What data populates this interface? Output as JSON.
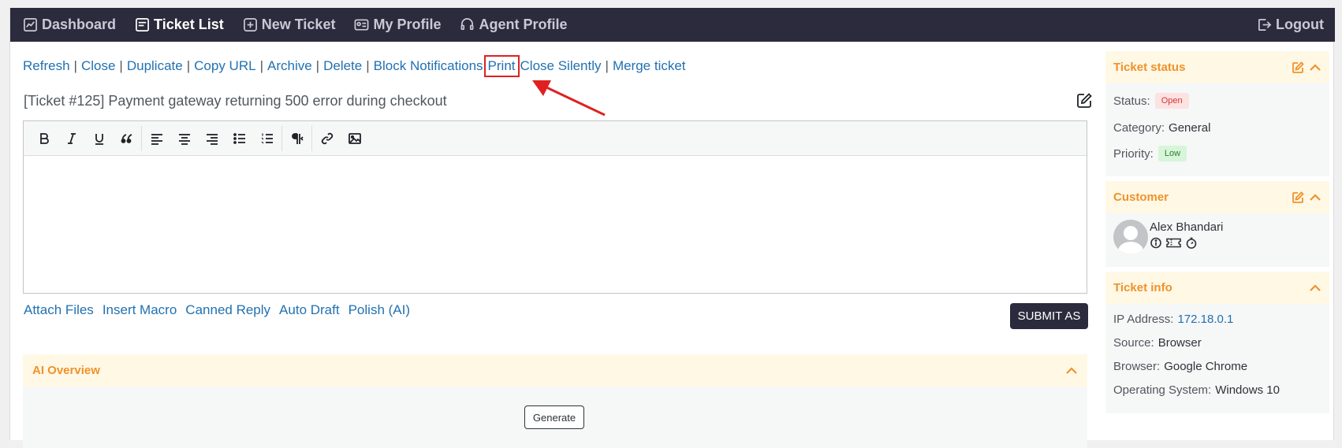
{
  "nav": {
    "items": [
      {
        "label": "Dashboard",
        "icon": "chart-icon"
      },
      {
        "label": "Ticket List",
        "icon": "list-icon"
      },
      {
        "label": "New Ticket",
        "icon": "plus-square-icon"
      },
      {
        "label": "My Profile",
        "icon": "id-card-icon"
      },
      {
        "label": "Agent Profile",
        "icon": "headset-icon"
      }
    ],
    "logout": "Logout"
  },
  "actions": [
    "Refresh",
    "Close",
    "Duplicate",
    "Copy URL",
    "Archive",
    "Delete",
    "Block Notifications",
    "Print",
    "Close Silently",
    "Merge ticket"
  ],
  "ticket": {
    "subject": "[Ticket #125] Payment gateway returning 500 error during checkout"
  },
  "editor": {
    "toolbar": [
      "bold-icon",
      "italic-icon",
      "underline-icon",
      "quote-icon",
      "align-left-icon",
      "align-center-icon",
      "align-right-icon",
      "bullet-list-icon",
      "numbered-list-icon",
      "paragraph-direction-icon",
      "link-icon",
      "image-icon"
    ]
  },
  "reply_links": [
    "Attach Files",
    "Insert Macro",
    "Canned Reply",
    "Auto Draft",
    "Polish (AI)"
  ],
  "submit_label": "SUBMIT AS",
  "ai_overview": {
    "title": "AI Overview",
    "generate_label": "Generate"
  },
  "sidebar": {
    "status": {
      "title": "Ticket status",
      "status_label": "Status:",
      "status_value": "Open",
      "category_label": "Category:",
      "category_value": "General",
      "priority_label": "Priority:",
      "priority_value": "Low"
    },
    "customer": {
      "title": "Customer",
      "name": "Alex Bhandari"
    },
    "info": {
      "title": "Ticket info",
      "ip_label": "IP Address:",
      "ip_value": "172.18.0.1",
      "source_label": "Source:",
      "source_value": "Browser",
      "browser_label": "Browser:",
      "browser_value": "Google Chrome",
      "os_label": "Operating System:",
      "os_value": "Windows 10"
    }
  },
  "colors": {
    "nav_bg": "#2b2b3d",
    "link": "#2271b1",
    "accent_orange": "#f0922b",
    "highlight_red": "#e02020"
  }
}
